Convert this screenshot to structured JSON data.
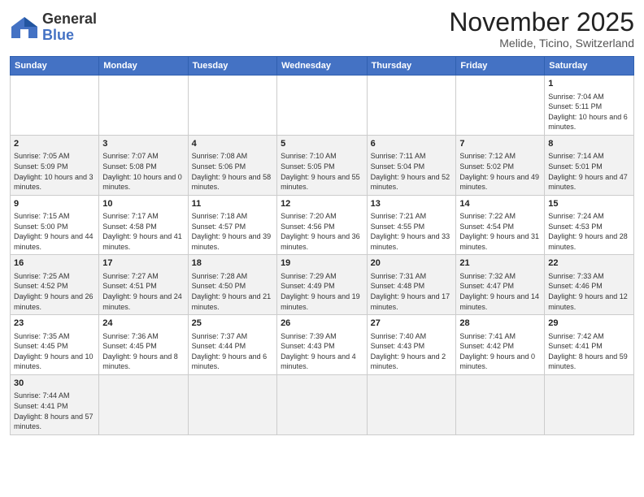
{
  "logo": {
    "text_general": "General",
    "text_blue": "Blue"
  },
  "title": {
    "month_year": "November 2025",
    "location": "Melide, Ticino, Switzerland"
  },
  "days_of_week": [
    "Sunday",
    "Monday",
    "Tuesday",
    "Wednesday",
    "Thursday",
    "Friday",
    "Saturday"
  ],
  "weeks": [
    [
      {
        "day": "",
        "info": ""
      },
      {
        "day": "",
        "info": ""
      },
      {
        "day": "",
        "info": ""
      },
      {
        "day": "",
        "info": ""
      },
      {
        "day": "",
        "info": ""
      },
      {
        "day": "",
        "info": ""
      },
      {
        "day": "1",
        "info": "Sunrise: 7:04 AM\nSunset: 5:11 PM\nDaylight: 10 hours and 6 minutes."
      }
    ],
    [
      {
        "day": "2",
        "info": "Sunrise: 7:05 AM\nSunset: 5:09 PM\nDaylight: 10 hours and 3 minutes."
      },
      {
        "day": "3",
        "info": "Sunrise: 7:07 AM\nSunset: 5:08 PM\nDaylight: 10 hours and 0 minutes."
      },
      {
        "day": "4",
        "info": "Sunrise: 7:08 AM\nSunset: 5:06 PM\nDaylight: 9 hours and 58 minutes."
      },
      {
        "day": "5",
        "info": "Sunrise: 7:10 AM\nSunset: 5:05 PM\nDaylight: 9 hours and 55 minutes."
      },
      {
        "day": "6",
        "info": "Sunrise: 7:11 AM\nSunset: 5:04 PM\nDaylight: 9 hours and 52 minutes."
      },
      {
        "day": "7",
        "info": "Sunrise: 7:12 AM\nSunset: 5:02 PM\nDaylight: 9 hours and 49 minutes."
      },
      {
        "day": "8",
        "info": "Sunrise: 7:14 AM\nSunset: 5:01 PM\nDaylight: 9 hours and 47 minutes."
      }
    ],
    [
      {
        "day": "9",
        "info": "Sunrise: 7:15 AM\nSunset: 5:00 PM\nDaylight: 9 hours and 44 minutes."
      },
      {
        "day": "10",
        "info": "Sunrise: 7:17 AM\nSunset: 4:58 PM\nDaylight: 9 hours and 41 minutes."
      },
      {
        "day": "11",
        "info": "Sunrise: 7:18 AM\nSunset: 4:57 PM\nDaylight: 9 hours and 39 minutes."
      },
      {
        "day": "12",
        "info": "Sunrise: 7:20 AM\nSunset: 4:56 PM\nDaylight: 9 hours and 36 minutes."
      },
      {
        "day": "13",
        "info": "Sunrise: 7:21 AM\nSunset: 4:55 PM\nDaylight: 9 hours and 33 minutes."
      },
      {
        "day": "14",
        "info": "Sunrise: 7:22 AM\nSunset: 4:54 PM\nDaylight: 9 hours and 31 minutes."
      },
      {
        "day": "15",
        "info": "Sunrise: 7:24 AM\nSunset: 4:53 PM\nDaylight: 9 hours and 28 minutes."
      }
    ],
    [
      {
        "day": "16",
        "info": "Sunrise: 7:25 AM\nSunset: 4:52 PM\nDaylight: 9 hours and 26 minutes."
      },
      {
        "day": "17",
        "info": "Sunrise: 7:27 AM\nSunset: 4:51 PM\nDaylight: 9 hours and 24 minutes."
      },
      {
        "day": "18",
        "info": "Sunrise: 7:28 AM\nSunset: 4:50 PM\nDaylight: 9 hours and 21 minutes."
      },
      {
        "day": "19",
        "info": "Sunrise: 7:29 AM\nSunset: 4:49 PM\nDaylight: 9 hours and 19 minutes."
      },
      {
        "day": "20",
        "info": "Sunrise: 7:31 AM\nSunset: 4:48 PM\nDaylight: 9 hours and 17 minutes."
      },
      {
        "day": "21",
        "info": "Sunrise: 7:32 AM\nSunset: 4:47 PM\nDaylight: 9 hours and 14 minutes."
      },
      {
        "day": "22",
        "info": "Sunrise: 7:33 AM\nSunset: 4:46 PM\nDaylight: 9 hours and 12 minutes."
      }
    ],
    [
      {
        "day": "23",
        "info": "Sunrise: 7:35 AM\nSunset: 4:45 PM\nDaylight: 9 hours and 10 minutes."
      },
      {
        "day": "24",
        "info": "Sunrise: 7:36 AM\nSunset: 4:45 PM\nDaylight: 9 hours and 8 minutes."
      },
      {
        "day": "25",
        "info": "Sunrise: 7:37 AM\nSunset: 4:44 PM\nDaylight: 9 hours and 6 minutes."
      },
      {
        "day": "26",
        "info": "Sunrise: 7:39 AM\nSunset: 4:43 PM\nDaylight: 9 hours and 4 minutes."
      },
      {
        "day": "27",
        "info": "Sunrise: 7:40 AM\nSunset: 4:43 PM\nDaylight: 9 hours and 2 minutes."
      },
      {
        "day": "28",
        "info": "Sunrise: 7:41 AM\nSunset: 4:42 PM\nDaylight: 9 hours and 0 minutes."
      },
      {
        "day": "29",
        "info": "Sunrise: 7:42 AM\nSunset: 4:41 PM\nDaylight: 8 hours and 59 minutes."
      }
    ],
    [
      {
        "day": "30",
        "info": "Sunrise: 7:44 AM\nSunset: 4:41 PM\nDaylight: 8 hours and 57 minutes."
      },
      {
        "day": "",
        "info": ""
      },
      {
        "day": "",
        "info": ""
      },
      {
        "day": "",
        "info": ""
      },
      {
        "day": "",
        "info": ""
      },
      {
        "day": "",
        "info": ""
      },
      {
        "day": "",
        "info": ""
      }
    ]
  ]
}
